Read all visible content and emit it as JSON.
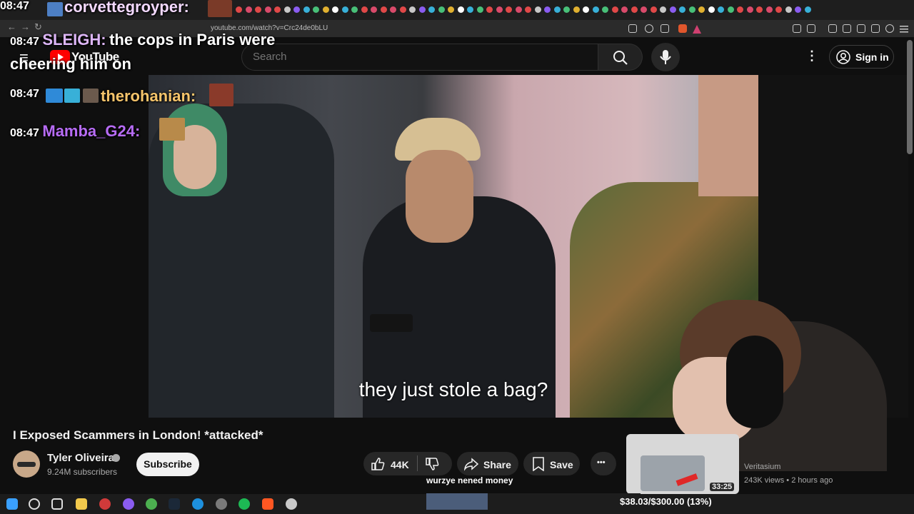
{
  "browser": {
    "url": "youtube.com/watch?v=Crc24de0bLU",
    "nav_back": "←",
    "nav_forward": "→",
    "nav_reload": "↻"
  },
  "youtube": {
    "wordmark": "YouTube",
    "search_placeholder": "Search",
    "sign_in": "Sign in",
    "menu_glyph": "≡",
    "more_glyph": "⋮"
  },
  "video": {
    "subtitle": "they just stole a bag?",
    "title": "I Exposed Scammers in London! *attacked*",
    "channel_name": "Tyler Oliveira",
    "subscribers": "9.24M subscribers",
    "subscribe_label": "Subscribe",
    "likes": "44K",
    "share_label": "Share",
    "save_label": "Save",
    "more_glyph": "•••"
  },
  "related": {
    "duration": "33:25",
    "channel": "Veritasium",
    "meta": "243K views • 2 hours ago"
  },
  "chat": [
    {
      "time": "08:47",
      "user": "corvettegroyper:",
      "message": "",
      "color": "#f3d9ff"
    },
    {
      "time": "08:47",
      "user": "SLEIGH:",
      "message": "the cops in Paris were",
      "color": "#ddb6f7"
    },
    {
      "time": "",
      "user": "",
      "message": "cheering him on",
      "color": "#ffffff"
    },
    {
      "time": "08:47",
      "user": "therohanian:",
      "message": "",
      "color": "#f5c46b"
    },
    {
      "time": "08:47",
      "user": "Mamba_G24:",
      "message": "",
      "color": "#b76cf5"
    }
  ],
  "goal": {
    "label": "wurzye nened money",
    "text": "$38.03/$300.00 (13%)",
    "progress": 0.13
  },
  "colors": {
    "youtube_red": "#ff0000",
    "background": "#0f0f0f",
    "goal_fill": "#4b5d7a"
  }
}
